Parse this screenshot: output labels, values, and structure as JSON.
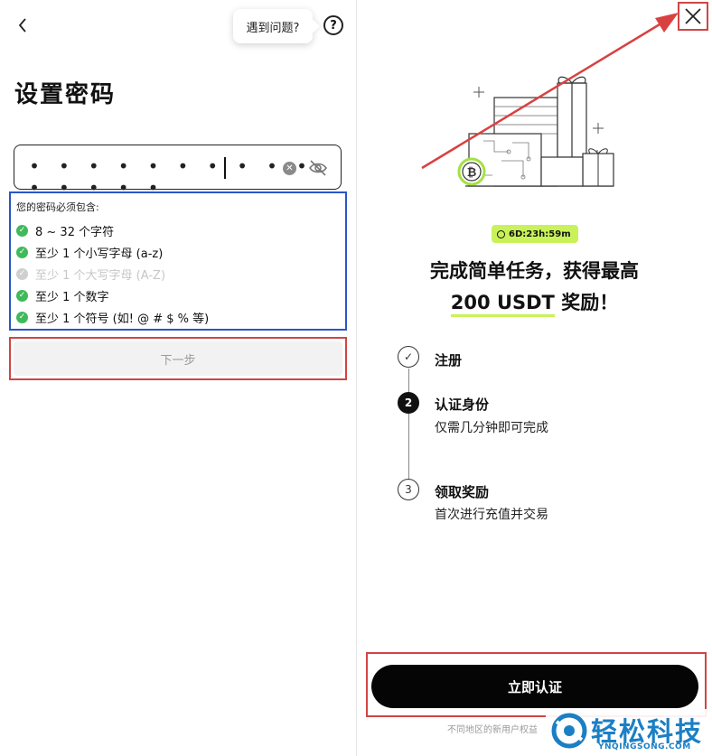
{
  "left": {
    "help_bubble": "遇到问题?",
    "help_icon": "?",
    "title": "设置密码",
    "password": {
      "masked_value": "• • • • • • • • • • • • • • •"
    },
    "rules_title": "您的密码必须包含:",
    "rules": [
      {
        "label": "8 ~ 32 个字符",
        "met": true
      },
      {
        "label": "至少 1 个小写字母 (a-z)",
        "met": true
      },
      {
        "label": "至少 1 个大写字母 (A-Z)",
        "met": false
      },
      {
        "label": "至少 1 个数字",
        "met": true
      },
      {
        "label": "至少 1 个符号 (如! @ # $ % 等)",
        "met": true
      }
    ],
    "next_button": "下一步"
  },
  "right": {
    "countdown": "6D:23h:59m",
    "headline_line1": "完成简单任务，获得最高",
    "headline_amount": "200 USDT",
    "headline_suffix": " 奖励！",
    "steps": [
      {
        "marker": "✓",
        "title": "注册",
        "subtitle": ""
      },
      {
        "marker": "2",
        "title": "认证身份",
        "subtitle": "仅需几分钟即可完成"
      },
      {
        "marker": "3",
        "title": "领取奖励",
        "subtitle": "首次进行充值并交易"
      }
    ],
    "verify_button": "立即认证",
    "footer_note": "不同地区的新用户权益"
  },
  "watermark": {
    "text": "轻松科技",
    "sub": "YNQINGSONG.COM"
  },
  "colors": {
    "accent_lime": "#c9f25a",
    "annotation_red": "#d04545",
    "annotation_blue": "#2a56c6",
    "check_green": "#3fba5a",
    "watermark_blue": "#1b7fc4"
  },
  "icons": [
    "back-chevron-icon",
    "help-icon",
    "clear-icon",
    "eye-off-icon",
    "close-icon",
    "bitcoin-icon",
    "clock-icon",
    "check-icon"
  ]
}
